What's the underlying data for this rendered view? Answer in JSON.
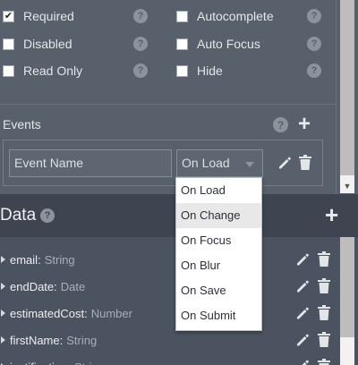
{
  "properties": {
    "options": [
      {
        "left": {
          "label": "Required",
          "checked": true
        },
        "right": {
          "label": "Autocomplete",
          "checked": false
        }
      },
      {
        "left": {
          "label": "Disabled",
          "checked": false
        },
        "right": {
          "label": "Auto Focus",
          "checked": false
        }
      },
      {
        "left": {
          "label": "Read Only",
          "checked": false
        },
        "right": {
          "label": "Hide",
          "checked": false
        }
      }
    ],
    "help_glyph": "?",
    "check_glyph": "✔"
  },
  "events": {
    "label": "Events",
    "add_glyph": "+",
    "name_placeholder": "Event Name",
    "selected": "On Load",
    "options": [
      "On Load",
      "On Change",
      "On Focus",
      "On Blur",
      "On Save",
      "On Submit"
    ],
    "highlighted": "On Change"
  },
  "data": {
    "title": "Data",
    "add_glyph": "+",
    "fields": [
      {
        "name": "email",
        "type": "String"
      },
      {
        "name": "endDate",
        "type": "Date"
      },
      {
        "name": "estimatedCost",
        "type": "Number"
      },
      {
        "name": "firstName",
        "type": "String"
      },
      {
        "name": "justification",
        "type": "String"
      }
    ]
  },
  "colors": {
    "panel": "#58606c",
    "header": "#3e4551",
    "list": "#4b5360",
    "dropdown_hover": "#e8e8e8"
  },
  "icons": [
    "help-icon",
    "add-icon",
    "edit-icon",
    "trash-icon",
    "checkbox-icon",
    "caret-down-icon",
    "expand-triangle-icon"
  ]
}
